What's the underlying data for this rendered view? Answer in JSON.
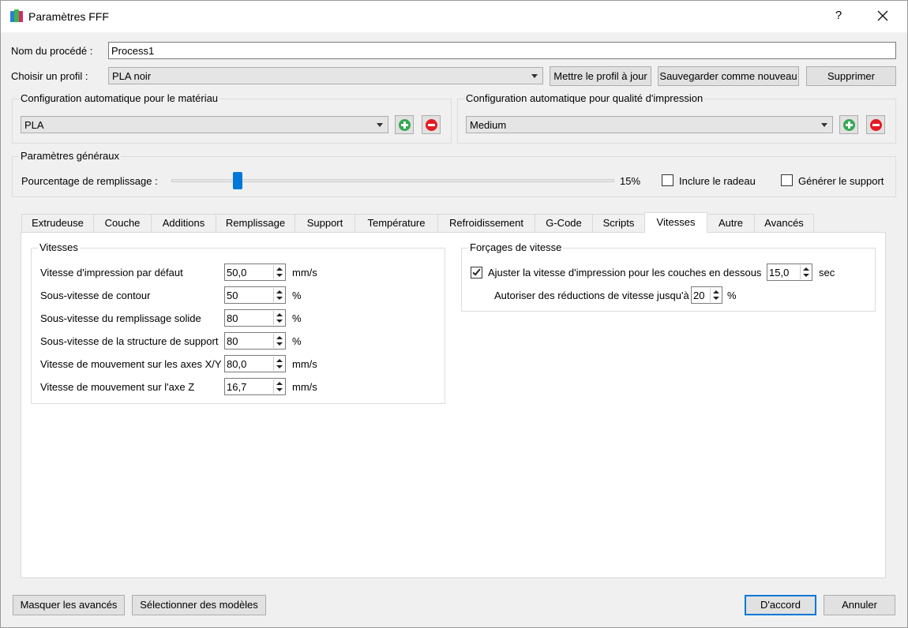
{
  "window": {
    "title": "Paramètres FFF",
    "help": "?"
  },
  "process": {
    "name_label": "Nom du procédé :",
    "name_value": "Process1"
  },
  "profile": {
    "label": "Choisir un profil :",
    "selected": "PLA noir",
    "update_btn": "Mettre le profil à jour",
    "save_new_btn": "Sauvegarder comme nouveau",
    "delete_btn": "Supprimer"
  },
  "auto_material": {
    "title": "Configuration automatique pour le matériau",
    "selected": "PLA"
  },
  "auto_quality": {
    "title": "Configuration automatique pour qualité d'impression",
    "selected": "Medium"
  },
  "general": {
    "title": "Paramètres généraux",
    "infill_label": "Pourcentage de remplissage :",
    "infill_value": "15%",
    "infill_fraction": 0.15,
    "raft_label": "Inclure le radeau",
    "raft_checked": false,
    "support_label": "Générer le support",
    "support_checked": false
  },
  "tabs": [
    {
      "label": "Extrudeuse"
    },
    {
      "label": "Couche"
    },
    {
      "label": "Additions"
    },
    {
      "label": "Remplissage"
    },
    {
      "label": "Support"
    },
    {
      "label": "Température"
    },
    {
      "label": "Refroidissement"
    },
    {
      "label": "G-Code"
    },
    {
      "label": "Scripts"
    },
    {
      "label": "Vitesses"
    },
    {
      "label": "Autre"
    },
    {
      "label": "Avancés"
    }
  ],
  "active_tab": "Vitesses",
  "speeds": {
    "title": "Vitesses",
    "rows": [
      {
        "label": "Vitesse d'impression par défaut",
        "value": "50,0",
        "unit": "mm/s"
      },
      {
        "label": "Sous-vitesse de contour",
        "value": "50",
        "unit": "%"
      },
      {
        "label": "Sous-vitesse du remplissage solide",
        "value": "80",
        "unit": "%"
      },
      {
        "label": "Sous-vitesse de la structure de support",
        "value": "80",
        "unit": "%"
      },
      {
        "label": "Vitesse de mouvement sur les axes X/Y",
        "value": "80,0",
        "unit": "mm/s"
      },
      {
        "label": "Vitesse de mouvement sur l'axe Z",
        "value": "16,7",
        "unit": "mm/s"
      }
    ]
  },
  "overrides": {
    "title": "Forçages de vitesse",
    "adjust_label": "Ajuster la vitesse d'impression pour les couches en dessous",
    "adjust_checked": true,
    "adjust_value": "15,0",
    "adjust_unit": "sec",
    "reduce_label": "Autoriser des réductions de vitesse jusqu'à",
    "reduce_value": "20",
    "reduce_unit": "%"
  },
  "footer": {
    "hide_advanced": "Masquer les avancés",
    "select_models": "Sélectionner des modèles",
    "ok": "D'accord",
    "cancel": "Annuler"
  },
  "colors": {
    "accent": "#0078d7",
    "add": "#34a853",
    "remove": "#e31b23"
  }
}
